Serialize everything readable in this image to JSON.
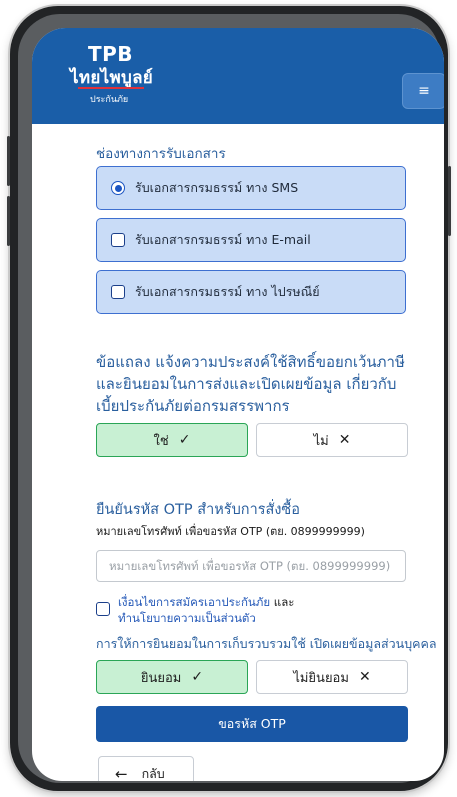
{
  "header": {
    "logo_main": "TPB",
    "logo_thai": "ไทยไพบูลย์",
    "logo_sub": "ประกันภัย",
    "menu_icon": "hamburger-menu-icon"
  },
  "document_channel": {
    "label": "ช่องทางการรับเอกสาร",
    "options": [
      {
        "label": "รับเอกสารกรมธรรม์ ทาง SMS",
        "selected": true
      },
      {
        "label": "รับเอกสารกรมธรรม์ ทาง E-mail",
        "selected": false
      },
      {
        "label": "รับเอกสารกรมธรรม์ ทาง ไปรษณีย์",
        "selected": false
      }
    ]
  },
  "tax_consent": {
    "label": "ข้อแถลง แจ้งความประสงค์ใช้สิทธิ์ขอยกเว้นภาษีและยินยอมในการส่งและเปิดเผยข้อมูล เกี่ยวกับเบี้ยประกันภัยต่อกรมสรรพากร",
    "yes_label": "ใช่",
    "yes_mark": "✓",
    "no_label": "ไม่",
    "no_mark": "✕"
  },
  "otp": {
    "label": "ยืนยันรหัส OTP สำหรับการสั่งซื้อ",
    "sublabel": "หมายเลขโทรศัพท์ เพื่อขอรหัส OTP (ตย. 0899999999)",
    "placeholder": "หมายเลขโทรศัพท์ เพื่อขอรหัส OTP (ตย. 0899999999)",
    "value": ""
  },
  "terms": {
    "link_text": "เงื่อนไขการสมัครเอาประกันภัย",
    "and_text": " และ",
    "policy_text": "ทำนโยบายความเป็นส่วนตัว",
    "checked": false
  },
  "personal_data_consent": {
    "label": "การให้การยินยอมในการเก็บรวบรวมใช้ เปิดเผยข้อมูลส่วนบุคคล",
    "agree_label": "ยินยอม",
    "agree_mark": "✓",
    "disagree_label": "ไม่ยินยอม",
    "disagree_mark": "✕"
  },
  "request_otp_button": "ขอรหัส OTP",
  "back_button": {
    "arrow": "←",
    "label": "กลับ"
  },
  "colors": {
    "header_blue": "#1a5ea8",
    "option_fill": "#c9dcf7",
    "option_border": "#3d6fd0",
    "green_fill": "#c8f0d3",
    "green_border": "#2aa556",
    "label_blue": "#2a5f9e",
    "button_blue": "#1957a6"
  }
}
